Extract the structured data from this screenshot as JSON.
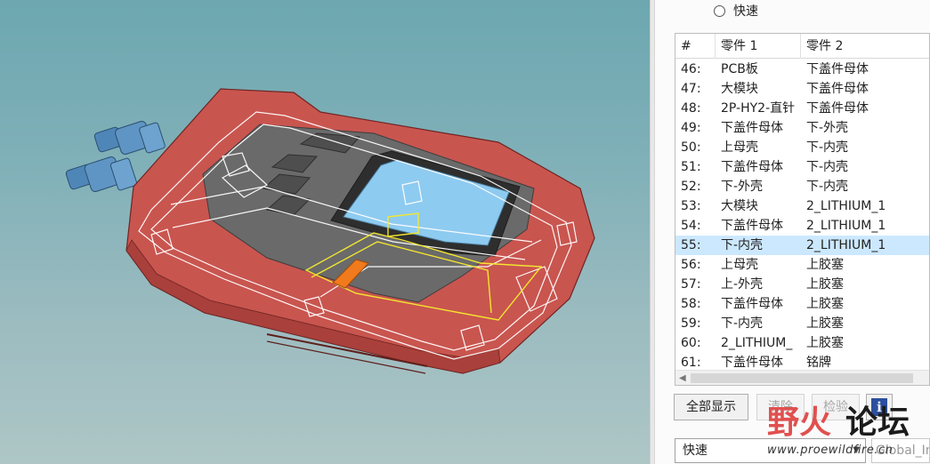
{
  "top_option": {
    "label": "快速",
    "selected": false
  },
  "table": {
    "headers": [
      "#",
      "零件 1",
      "零件 2"
    ],
    "rows": [
      {
        "num": "46:",
        "part1": "PCB板",
        "part2": "下盖件母体"
      },
      {
        "num": "47:",
        "part1": "大模块",
        "part2": "下盖件母体"
      },
      {
        "num": "48:",
        "part1": "2P-HY2-直针",
        "part2": "下盖件母体"
      },
      {
        "num": "49:",
        "part1": "下盖件母体",
        "part2": "下-外壳"
      },
      {
        "num": "50:",
        "part1": "上母壳",
        "part2": "下-内壳"
      },
      {
        "num": "51:",
        "part1": "下盖件母体",
        "part2": "下-内壳"
      },
      {
        "num": "52:",
        "part1": "下-外壳",
        "part2": "下-内壳"
      },
      {
        "num": "53:",
        "part1": "大模块",
        "part2": "2_LITHIUM_1"
      },
      {
        "num": "54:",
        "part1": "下盖件母体",
        "part2": "2_LITHIUM_1"
      },
      {
        "num": "55:",
        "part1": "下-内壳",
        "part2": "2_LITHIUM_1"
      },
      {
        "num": "56:",
        "part1": "上母壳",
        "part2": "上胶塞"
      },
      {
        "num": "57:",
        "part1": "上-外壳",
        "part2": "上胶塞"
      },
      {
        "num": "58:",
        "part1": "下盖件母体",
        "part2": "上胶塞"
      },
      {
        "num": "59:",
        "part1": "下-内壳",
        "part2": "上胶塞"
      },
      {
        "num": "60:",
        "part1": "2_LITHIUM_",
        "part2": "上胶塞"
      },
      {
        "num": "61:",
        "part1": "下盖件母体",
        "part2": "铭牌"
      }
    ],
    "selected_row": "55:"
  },
  "buttons": {
    "show_all": "全部显示",
    "clear": "清除",
    "check": "检验"
  },
  "info_icon": "info-icon",
  "mode_select": {
    "value": "快速"
  },
  "coord_select": {
    "value": "Global_Inte"
  },
  "watermark": {
    "cn_red": "野火",
    "cn_dark": "论坛",
    "url": "www.proewildfire.cn"
  },
  "colors": {
    "viewport_bg": "#7fb0b7",
    "housing_red": "#c9554f",
    "screen_blue": "#8ecbf0",
    "selection": "#cce8ff",
    "connector_blue": "#5b8fbd",
    "highlight_orange": "#f07a1c"
  }
}
